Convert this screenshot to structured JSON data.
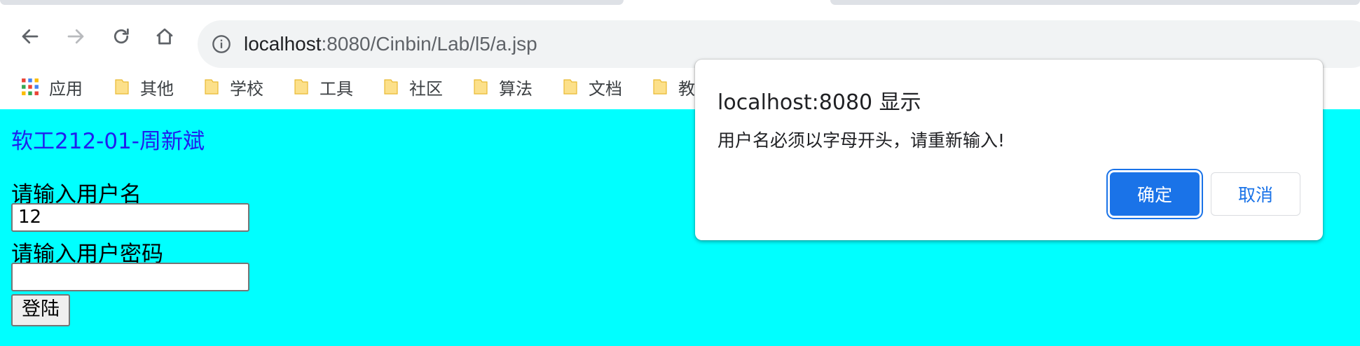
{
  "browser": {
    "url_host": "localhost",
    "url_path": ":8080/Cinbin/Lab/l5/a.jsp",
    "bookmarks": [
      {
        "label": "应用",
        "icon": "apps-grid-icon"
      },
      {
        "label": "其他",
        "icon": "folder-icon"
      },
      {
        "label": "学校",
        "icon": "folder-icon"
      },
      {
        "label": "工具",
        "icon": "folder-icon"
      },
      {
        "label": "社区",
        "icon": "folder-icon"
      },
      {
        "label": "算法",
        "icon": "folder-icon"
      },
      {
        "label": "文档",
        "icon": "folder-icon"
      },
      {
        "label": "教",
        "icon": "folder-icon"
      }
    ]
  },
  "page": {
    "heading": "软工212-01-周新斌",
    "username_label": "请输入用户名",
    "username_value": "12",
    "password_label": "请输入用户密码",
    "password_value": "",
    "login_button": "登陆",
    "background_color": "#00ffff",
    "heading_color": "#2020ee"
  },
  "dialog": {
    "title": "localhost:8080 显示",
    "message": "用户名必须以字母开头，请重新输入!",
    "ok_label": "确定",
    "cancel_label": "取消",
    "accent_color": "#1a73e8"
  }
}
